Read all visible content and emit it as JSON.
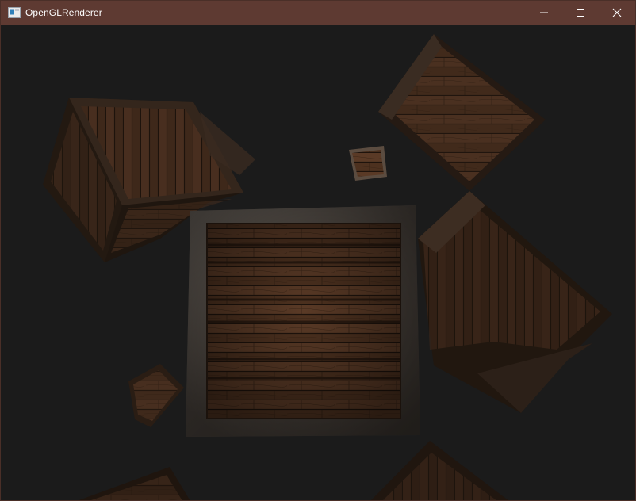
{
  "window": {
    "title": "OpenGLRenderer",
    "titlebar_color": "#5e3a32",
    "clear_color": "#1b1b1b"
  },
  "controls": {
    "minimize_icon": "minimize-icon",
    "maximize_icon": "maximize-icon",
    "close_icon": "close-icon"
  },
  "scene": {
    "object_kind": "wooden crate",
    "crate_count": 9
  }
}
